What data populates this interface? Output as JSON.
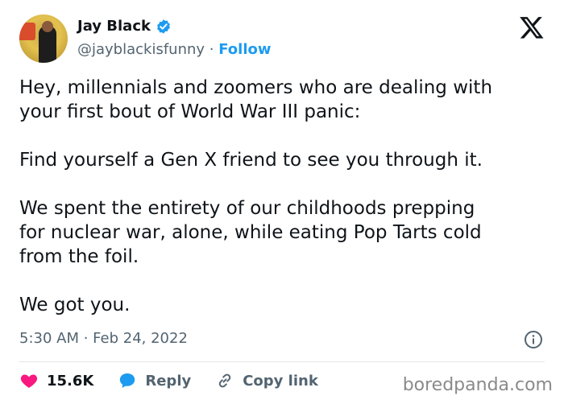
{
  "author": {
    "name": "Jay Black",
    "handle": "@jayblackisfunny",
    "separator": " · ",
    "follow_label": "Follow"
  },
  "tweet": {
    "text": "Hey, millennials and zoomers who are dealing with\nyour first bout of World War III panic:\n\nFind yourself a Gen X friend to see you through it.\n\nWe spent the entirety of our childhoods prepping\nfor nuclear war, alone, while eating Pop Tarts cold\nfrom the foil.\n\nWe got you.",
    "timestamp": "5:30 AM · Feb 24, 2022"
  },
  "actions": {
    "likes": "15.6K",
    "reply_label": "Reply",
    "copy_link_label": "Copy link"
  },
  "icons": {
    "verified": "verified-badge-icon",
    "platform": "x-logo-icon",
    "info": "info-icon",
    "like": "heart-icon",
    "reply": "speech-bubble-icon",
    "link": "link-icon"
  },
  "colors": {
    "accent": "#1d9bf0",
    "like": "#f91880",
    "muted": "#536471",
    "text": "#0f1419"
  },
  "watermark": "boredpanda.com"
}
